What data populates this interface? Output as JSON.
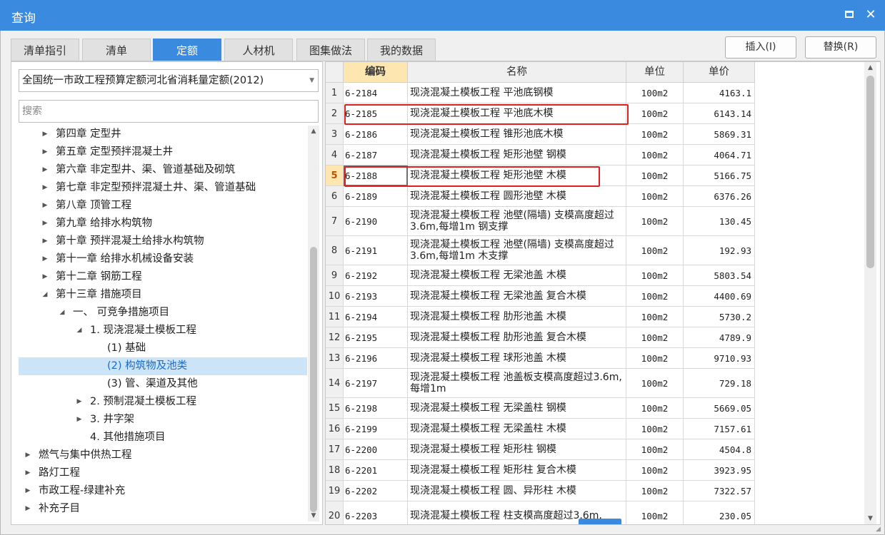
{
  "window": {
    "title": "查询",
    "maximize_icon": "maximize-icon",
    "close_icon": "close-icon",
    "close_glyph": "✕"
  },
  "tabs": [
    {
      "label": "清单指引",
      "active": false
    },
    {
      "label": "清单",
      "active": false
    },
    {
      "label": "定额",
      "active": true
    },
    {
      "label": "人材机",
      "active": false
    },
    {
      "label": "图集做法",
      "active": false
    },
    {
      "label": "我的数据",
      "active": false
    }
  ],
  "actions": {
    "insert_label": "插入(I)",
    "replace_label": "替换(R)"
  },
  "left": {
    "quota_select": "全国统一市政工程预算定额河北省消耗量定额(2012)",
    "search_placeholder": "搜索",
    "tree": [
      {
        "label": "第四章 定型井",
        "state": "collapsed",
        "level": 1
      },
      {
        "label": "第五章 定型预拌混凝土井",
        "state": "collapsed",
        "level": 1
      },
      {
        "label": "第六章 非定型井、渠、管道基础及砌筑",
        "state": "collapsed",
        "level": 1
      },
      {
        "label": "第七章 非定型预拌混凝土井、渠、管道基础",
        "state": "collapsed",
        "level": 1
      },
      {
        "label": "第八章 顶管工程",
        "state": "collapsed",
        "level": 1
      },
      {
        "label": "第九章 给排水构筑物",
        "state": "collapsed",
        "level": 1
      },
      {
        "label": "第十章 预拌混凝土给排水构筑物",
        "state": "collapsed",
        "level": 1
      },
      {
        "label": "第十一章 给排水机械设备安装",
        "state": "collapsed",
        "level": 1
      },
      {
        "label": "第十二章 钢筋工程",
        "state": "collapsed",
        "level": 1
      },
      {
        "label": "第十三章 措施项目",
        "state": "expanded",
        "level": 1
      },
      {
        "label": "一、 可竞争措施项目",
        "state": "expanded",
        "level": 2
      },
      {
        "label": "1. 现浇混凝土模板工程",
        "state": "expanded",
        "level": 3
      },
      {
        "label": "(1) 基础",
        "state": "leaf",
        "level": 4
      },
      {
        "label": "(2) 构筑物及池类",
        "state": "leaf",
        "level": 4,
        "selected": true
      },
      {
        "label": "(3) 管、渠道及其他",
        "state": "leaf",
        "level": 4
      },
      {
        "label": "2. 预制混凝土模板工程",
        "state": "collapsed",
        "level": 3
      },
      {
        "label": "3. 井字架",
        "state": "collapsed",
        "level": 3
      },
      {
        "label": "4. 其他措施项目",
        "state": "leaf",
        "level": 3
      },
      {
        "label": "燃气与集中供热工程",
        "state": "collapsed",
        "level": 0
      },
      {
        "label": "路灯工程",
        "state": "collapsed",
        "level": 0
      },
      {
        "label": "市政工程-绿建补充",
        "state": "collapsed",
        "level": 0
      },
      {
        "label": "补充子目",
        "state": "collapsed",
        "level": 0
      }
    ]
  },
  "grid": {
    "columns": {
      "code": "编码",
      "name": "名称",
      "unit": "单位",
      "price": "单价"
    },
    "active_row": 5,
    "highlighted_rows": [
      2,
      5
    ],
    "rows": [
      {
        "num": "1",
        "code": "6-2184",
        "name": "现浇混凝土模板工程 平池底钢模",
        "unit": "100m2",
        "price": "4163.1"
      },
      {
        "num": "2",
        "code": "6-2185",
        "name": "现浇混凝土模板工程 平池底木模",
        "unit": "100m2",
        "price": "6143.14"
      },
      {
        "num": "3",
        "code": "6-2186",
        "name": "现浇混凝土模板工程 锥形池底木模",
        "unit": "100m2",
        "price": "5869.31"
      },
      {
        "num": "4",
        "code": "6-2187",
        "name": "现浇混凝土模板工程 矩形池壁 钢模",
        "unit": "100m2",
        "price": "4064.71"
      },
      {
        "num": "5",
        "code": "6-2188",
        "name": "现浇混凝土模板工程 矩形池壁 木模",
        "unit": "100m2",
        "price": "5166.75"
      },
      {
        "num": "6",
        "code": "6-2189",
        "name": "现浇混凝土模板工程 圆形池壁 木模",
        "unit": "100m2",
        "price": "6376.26"
      },
      {
        "num": "7",
        "code": "6-2190",
        "name": "现浇混凝土模板工程 池壁(隔墙) 支模高度超过3.6m,每增1m 钢支撑",
        "unit": "100m2",
        "price": "130.45",
        "tall": true
      },
      {
        "num": "8",
        "code": "6-2191",
        "name": "现浇混凝土模板工程 池壁(隔墙) 支模高度超过3.6m,每增1m 木支撑",
        "unit": "100m2",
        "price": "192.93",
        "tall": true
      },
      {
        "num": "9",
        "code": "6-2192",
        "name": "现浇混凝土模板工程 无梁池盖 木模",
        "unit": "100m2",
        "price": "5803.54"
      },
      {
        "num": "10",
        "code": "6-2193",
        "name": "现浇混凝土模板工程 无梁池盖 复合木模",
        "unit": "100m2",
        "price": "4400.69"
      },
      {
        "num": "11",
        "code": "6-2194",
        "name": "现浇混凝土模板工程 肋形池盖 木模",
        "unit": "100m2",
        "price": "5730.2"
      },
      {
        "num": "12",
        "code": "6-2195",
        "name": "现浇混凝土模板工程 肋形池盖 复合木模",
        "unit": "100m2",
        "price": "4789.9"
      },
      {
        "num": "13",
        "code": "6-2196",
        "name": "现浇混凝土模板工程 球形池盖 木模",
        "unit": "100m2",
        "price": "9710.93"
      },
      {
        "num": "14",
        "code": "6-2197",
        "name": "现浇混凝土模板工程 池盖板支模高度超过3.6m,每增1m",
        "unit": "100m2",
        "price": "729.18",
        "tall": true
      },
      {
        "num": "15",
        "code": "6-2198",
        "name": "现浇混凝土模板工程 无梁盖柱 钢模",
        "unit": "100m2",
        "price": "5669.05"
      },
      {
        "num": "16",
        "code": "6-2199",
        "name": "现浇混凝土模板工程 无梁盖柱 木模",
        "unit": "100m2",
        "price": "7157.61"
      },
      {
        "num": "17",
        "code": "6-2200",
        "name": "现浇混凝土模板工程 矩形柱 钢模",
        "unit": "100m2",
        "price": "4504.8"
      },
      {
        "num": "18",
        "code": "6-2201",
        "name": "现浇混凝土模板工程 矩形柱 复合木模",
        "unit": "100m2",
        "price": "3923.95"
      },
      {
        "num": "19",
        "code": "6-2202",
        "name": "现浇混凝土模板工程 圆、异形柱 木模",
        "unit": "100m2",
        "price": "7322.57"
      },
      {
        "num": "20",
        "code": "6-2203",
        "name": "现浇混凝土模板工程 柱支模高度超过3.6m,",
        "unit": "100m2",
        "price": "230.05",
        "tall": true
      }
    ]
  },
  "colors": {
    "accent": "#3a8be0",
    "highlight_box": "#e02020",
    "code_header": "#fde6b0",
    "selected_tree": "#cce4f7"
  }
}
